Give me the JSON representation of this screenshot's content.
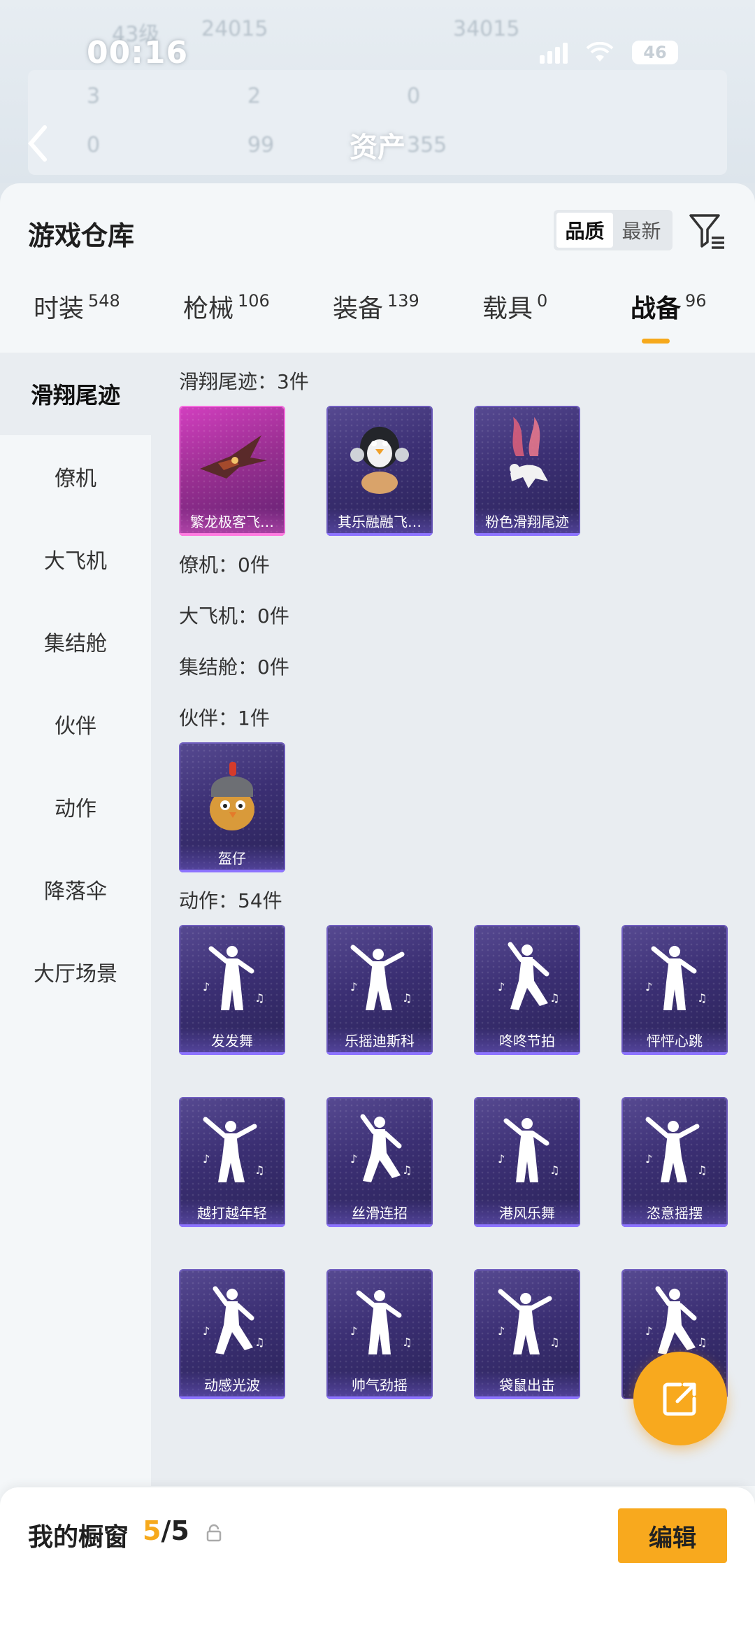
{
  "status": {
    "time": "00:16",
    "battery": "46"
  },
  "background": {
    "title": "资产",
    "ghost_texts": [
      "43级",
      "24015",
      "34015",
      "3",
      "2",
      "0",
      "0",
      "99",
      "355"
    ]
  },
  "sheet": {
    "title": "游戏仓库",
    "sort_options": [
      "品质",
      "最新"
    ],
    "active_sort": "品质"
  },
  "tabs": [
    {
      "label": "时装",
      "count": "548"
    },
    {
      "label": "枪械",
      "count": "106"
    },
    {
      "label": "装备",
      "count": "139"
    },
    {
      "label": "载具",
      "count": "0"
    },
    {
      "label": "战备",
      "count": "96",
      "active": true
    }
  ],
  "sidenav": [
    {
      "label": "滑翔尾迹",
      "active": true
    },
    {
      "label": "僚机"
    },
    {
      "label": "大飞机"
    },
    {
      "label": "集结舱"
    },
    {
      "label": "伙伴"
    },
    {
      "label": "动作"
    },
    {
      "label": "降落伞"
    },
    {
      "label": "大厅场景"
    }
  ],
  "sections": {
    "glide": {
      "heading": "滑翔尾迹：3件",
      "items": [
        "繁龙极客飞…",
        "其乐融融飞…",
        "粉色滑翔尾迹"
      ]
    },
    "wingman": {
      "heading": "僚机：0件"
    },
    "bigplane": {
      "heading": "大飞机：0件"
    },
    "capsule": {
      "heading": "集结舱：0件"
    },
    "partner": {
      "heading": "伙伴：1件",
      "items": [
        "盔仔"
      ]
    },
    "emote": {
      "heading": "动作：54件",
      "items": [
        "发发舞",
        "乐摇迪斯科",
        "咚咚节拍",
        "怦怦心跳",
        "越打越年轻",
        "丝滑连招",
        "港风乐舞",
        "恣意摇摆",
        "动感光波",
        "帅气劲摇",
        "袋鼠出击",
        ""
      ]
    }
  },
  "bottom": {
    "label": "我的橱窗",
    "count_current": "5",
    "count_sep": "/",
    "count_total": "5",
    "edit": "编辑"
  },
  "icons": {
    "filter": "filter-icon",
    "fab": "share-export-icon",
    "lock": "lock-icon",
    "back": "back-arrow-icon"
  },
  "colors": {
    "accent": "#f8a91e",
    "card_purple": "#3b2f73",
    "card_pink": "#d33fc0"
  }
}
